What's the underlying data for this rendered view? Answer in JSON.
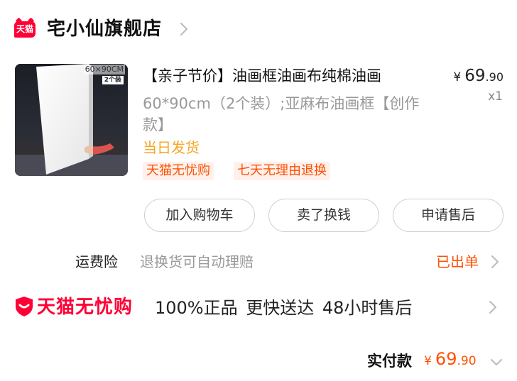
{
  "store": {
    "badge": "天猫",
    "name": "宅小仙旗舰店"
  },
  "product": {
    "thumb_size_label": "60×90CM",
    "thumb_count_label": "2个装",
    "title": "【亲子节价】油画框油画布纯棉油画",
    "price": {
      "currency": "¥",
      "integer": "69",
      "decimal": ".90"
    },
    "quantity": "x1",
    "spec": "60*90cm（2个装）;亚麻布油画框【创作款】",
    "shipping": "当日发货",
    "tags": [
      "天猫无忧购",
      "七天无理由退换"
    ]
  },
  "actions": {
    "add_to_cart": "加入购物车",
    "resell": "卖了换钱",
    "after_sales": "申请售后"
  },
  "insurance": {
    "label": "运费险",
    "description": "退换货可自动理赔",
    "status": "已出单"
  },
  "worry_free": {
    "brand": "天猫无忧购",
    "text": "100%正品 更快送达 48小时售后"
  },
  "total": {
    "label": "实付款",
    "price": {
      "currency": "¥",
      "integer": "69",
      "decimal": ".90"
    }
  },
  "colors": {
    "tmall_red": "#ff0036",
    "accent_orange": "#ff5000",
    "ship_yellow": "#f5a623"
  }
}
